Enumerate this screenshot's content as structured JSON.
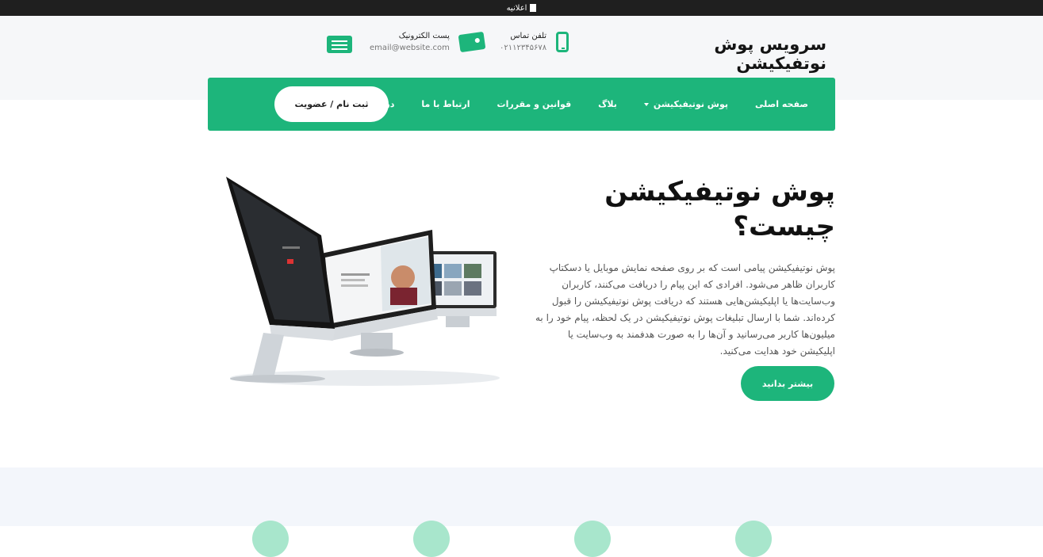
{
  "browser": {
    "tab_title": "اعلانیه"
  },
  "header": {
    "brand": "سرویس پوش نوتفیکیشن",
    "phone": {
      "title": "تلفن تماس",
      "value": "۰۲۱۱۲۳۴۵۶۷۸"
    },
    "email": {
      "title": "پست الکترونیک",
      "value": "email@website.com"
    }
  },
  "nav": {
    "items": [
      {
        "label": "صفحه اصلی"
      },
      {
        "label": "پوش نوتیفیکیشن"
      },
      {
        "label": "بلاگ"
      },
      {
        "label": "قوانین و مقررات"
      },
      {
        "label": "ارتباط با ما"
      },
      {
        "label": "درباره ما"
      }
    ],
    "signup_label": "ثبت نام / عضویت"
  },
  "hero": {
    "title_line1": "پوش نوتیفیکیشن",
    "title_line2": "چیست؟",
    "description": "پوش نوتیفیکیشن پیامی است که بر روی صفحه نمایش موبایل یا دسکتاپ کاربران ظاهر می‌شود. افرادی که این پیام را دریافت می‌کنند، کاربران وب‌سایت‌ها یا اپلیکیشن‌هایی هستند که دریافت پوش نوتیفیکیشن را قبول کرده‌اند. شما با ارسال تبلیغات پوش نوتیفیکیشن در یک لحظه، پیام خود را به میلیون‌ها کاربر می‌رسانید و آن‌ها را به صورت هدفمند به وب‌سایت یا اپلیکیشن خود هدایت می‌کنید.",
    "cta_label": "بیشتر بدانید"
  },
  "colors": {
    "accent": "#1db57b",
    "topbar": "#1f1f1f",
    "band": "#f6f7f9"
  },
  "icons": {
    "phone": "mobile-phone-icon",
    "email_1": "money-envelope-icon",
    "email_2": "mail-card-icon",
    "tab": "document-icon"
  }
}
